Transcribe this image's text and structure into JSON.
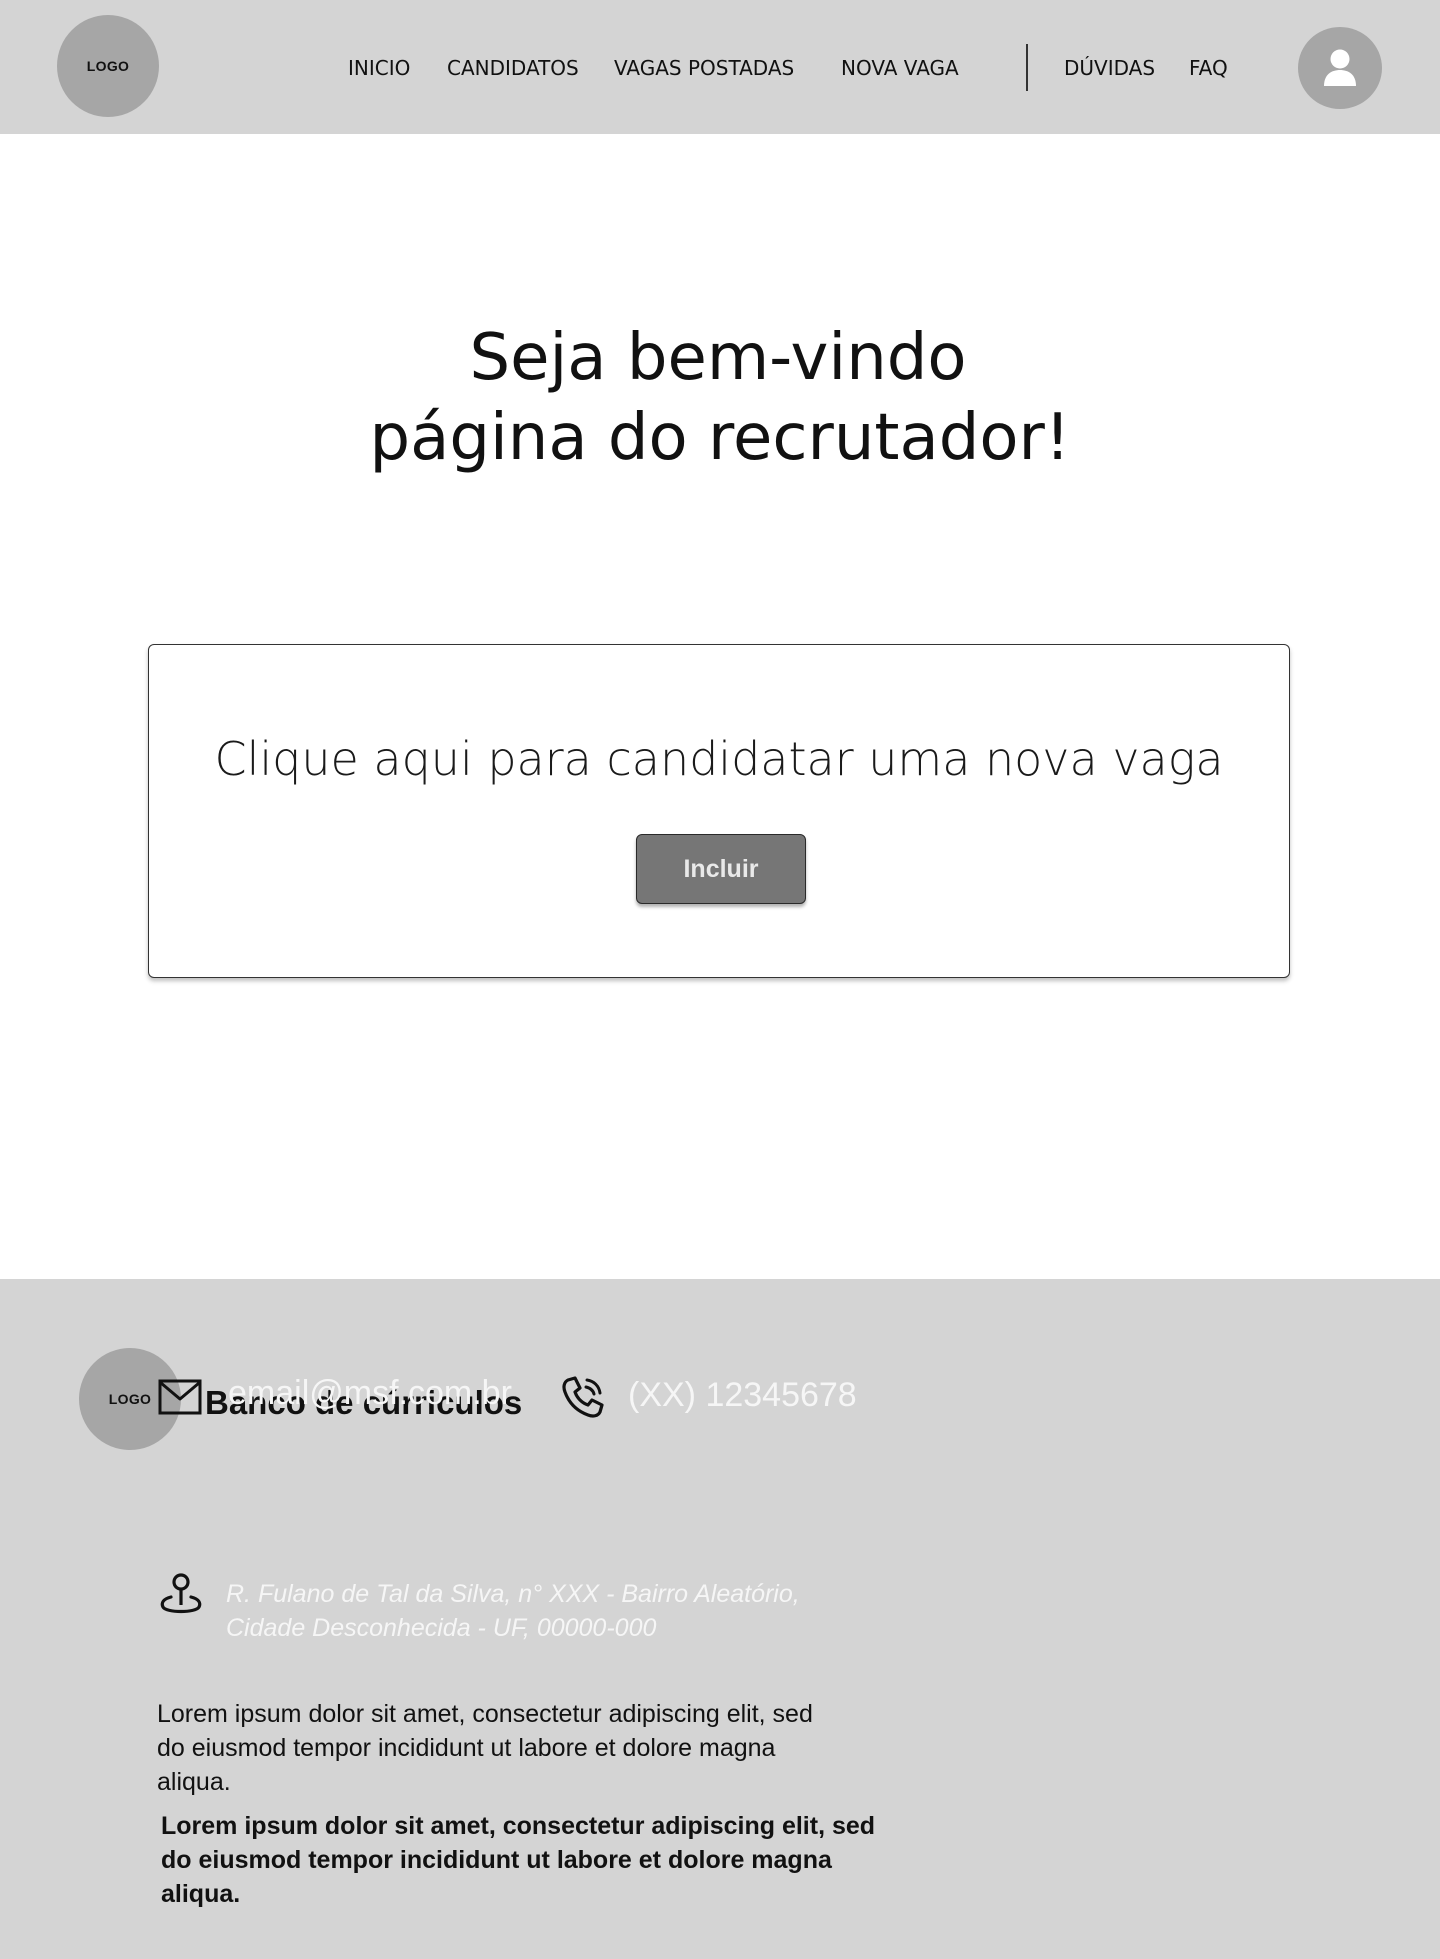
{
  "header": {
    "logo_label": "LOGO",
    "nav": [
      {
        "label": "INICIO"
      },
      {
        "label": "CANDIDATOS"
      },
      {
        "label": "VAGAS POSTADAS"
      },
      {
        "label": "NOVA VAGA"
      },
      {
        "label": "DÚVIDAS"
      },
      {
        "label": "FAQ"
      }
    ],
    "avatar_icon": "user-icon"
  },
  "hero": {
    "line1": "Seja bem-vindo",
    "line2": "página do recrutador!"
  },
  "card": {
    "text": "Clique aqui para candidatar uma nova vaga",
    "button_label": "Incluir"
  },
  "footer": {
    "logo_label": "LOGO",
    "brand": "Banco de cúrriculos",
    "email": "email@msf.com.br",
    "phone": "(XX) 12345678",
    "address_line1": "R. Fulano de Tal da Silva, n° XXX - Bairro Aleatório,",
    "address_line2": "Cidade Desconhecida - UF, 00000-000",
    "lorem_lines": [
      "Lorem ipsum dolor sit amet, consectetur adipiscing elit, sed",
      "do eiusmod tempor incididunt ut labore et dolore magna",
      "aliqua."
    ],
    "lorem_bold_lines": [
      "Lorem ipsum dolor sit amet, consectetur adipiscing elit, sed",
      "do eiusmod tempor incididunt ut labore et dolore magna",
      "aliqua."
    ]
  },
  "colors": {
    "header_bg": "#d4d4d4",
    "footer_bg": "#d4d4d4",
    "circle_gray": "#a6a6a6",
    "button_bg": "#767676",
    "button_text": "#e9e9e9"
  }
}
